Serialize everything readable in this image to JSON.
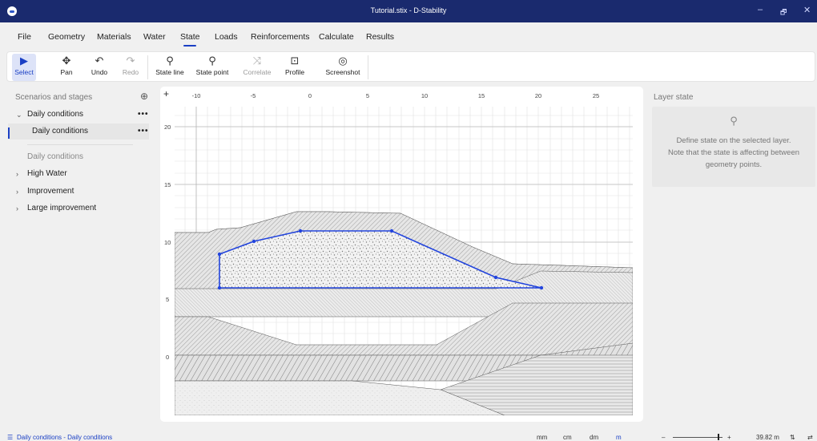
{
  "window": {
    "title": "Tutorial.stix - D-Stability",
    "minimize": "–",
    "maximize": "🗗",
    "close": "✕"
  },
  "menu": {
    "items": [
      "File",
      "Geometry",
      "Materials",
      "Water",
      "State",
      "Loads",
      "Reinforcements",
      "Calculate",
      "Results"
    ],
    "active": "State"
  },
  "toolbar": {
    "select": {
      "label": "Select",
      "icon": "▶"
    },
    "pan": {
      "label": "Pan",
      "icon": "✥"
    },
    "undo": {
      "label": "Undo",
      "icon": "↶"
    },
    "redo": {
      "label": "Redo",
      "icon": "↷"
    },
    "state_line": {
      "label": "State line",
      "icon": "⚲"
    },
    "state_point": {
      "label": "State point",
      "icon": "⚲"
    },
    "correlate": {
      "label": "Correlate",
      "icon": "⤨"
    },
    "profile": {
      "label": "Profile",
      "icon": "⊡"
    },
    "screenshot": {
      "label": "Screenshot",
      "icon": "◎"
    }
  },
  "sidebar": {
    "header": "Scenarios and stages",
    "add_icon": "⊕",
    "dots": "•••",
    "scenarios": [
      {
        "label": "Daily conditions",
        "chevron": "⌄"
      },
      {
        "label": "High Water",
        "chevron": "›"
      },
      {
        "label": "Improvement",
        "chevron": "›"
      },
      {
        "label": "Large improvement",
        "chevron": "›"
      }
    ],
    "stage_selected": "Daily conditions",
    "stage_caption": "Daily conditions"
  },
  "canvas": {
    "plus": "+",
    "x_ticks": [
      "-10",
      "-5",
      "0",
      "5",
      "10",
      "15",
      "20",
      "25"
    ],
    "y_ticks": [
      "20",
      "15",
      "10",
      "5",
      "0"
    ]
  },
  "right_panel": {
    "header": "Layer state",
    "icon": "⚲",
    "message_lines": [
      "Define state on the selected layer.",
      "Note that the state is affecting between",
      "geometry points."
    ]
  },
  "status": {
    "left_icon": "☰",
    "left_text": "Daily conditions - Daily conditions",
    "units": [
      "mm",
      "cm",
      "dm",
      "m"
    ],
    "active_unit": "m",
    "zoom_minus": "–",
    "zoom_plus": "+",
    "zoom_level": 0.9,
    "scale_text": "39.82 m",
    "icon_a": "⇅",
    "icon_b": "⇄"
  },
  "colors": {
    "accent": "#1a3fc4",
    "titlebar": "#1a2a6e",
    "selected_layer": "#2244dd"
  }
}
